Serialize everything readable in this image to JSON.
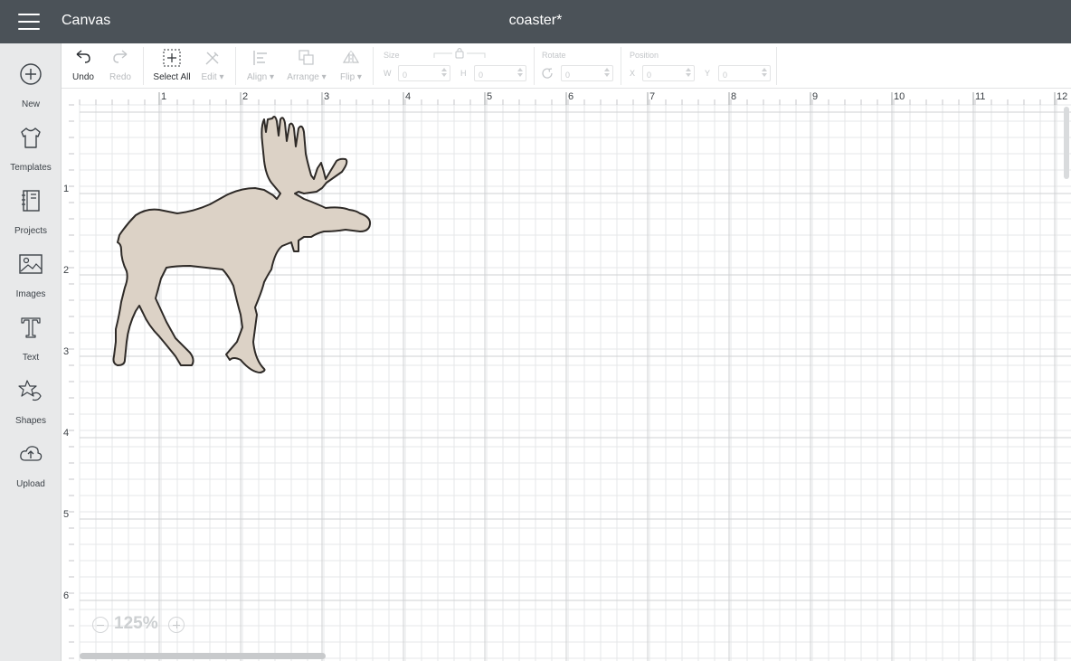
{
  "app": {
    "title": "Canvas",
    "document_title": "coaster*"
  },
  "sidebar": {
    "items": [
      {
        "label": "New",
        "icon": "plus-circle-icon"
      },
      {
        "label": "Templates",
        "icon": "tshirt-icon"
      },
      {
        "label": "Projects",
        "icon": "projects-icon"
      },
      {
        "label": "Images",
        "icon": "image-icon"
      },
      {
        "label": "Text",
        "icon": "text-icon"
      },
      {
        "label": "Shapes",
        "icon": "shapes-icon"
      },
      {
        "label": "Upload",
        "icon": "upload-cloud-icon"
      }
    ]
  },
  "toolbar": {
    "undo": "Undo",
    "redo": "Redo",
    "select_all": "Select All",
    "edit": "Edit",
    "align": "Align",
    "arrange": "Arrange",
    "flip": "Flip",
    "size_label": "Size",
    "w_label": "W",
    "w_value": "0",
    "h_label": "H",
    "h_value": "0",
    "rotate_label": "Rotate",
    "rotate_value": "0",
    "position_label": "Position",
    "x_label": "X",
    "x_value": "0",
    "y_label": "Y",
    "y_value": "0"
  },
  "ruler": {
    "top_labels": [
      "1",
      "2",
      "3",
      "4",
      "5",
      "6",
      "7",
      "8",
      "9",
      "10",
      "11",
      "12"
    ],
    "left_labels": [
      "1",
      "2",
      "3",
      "4",
      "5",
      "6"
    ]
  },
  "zoom": {
    "value": "125%"
  },
  "colors": {
    "topbar": "#4b5258",
    "sidebar": "#e8e9ea",
    "shape_fill": "#dcd2c6",
    "shape_stroke": "#2e2a27",
    "grid_major": "#cfd1d3",
    "grid_minor": "#e6e7e8"
  }
}
